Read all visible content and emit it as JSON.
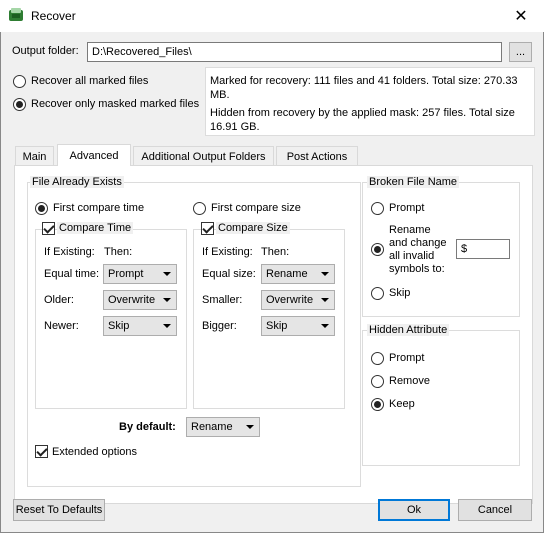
{
  "window": {
    "title": "Recover",
    "close_glyph": "✕"
  },
  "output": {
    "label": "Output folder:",
    "value": "D:\\Recovered_Files\\",
    "browse_label": "..."
  },
  "recover_mode": {
    "all_label": "Recover all marked files",
    "masked_label": "Recover only masked marked files",
    "selected": "masked"
  },
  "info": {
    "marked": "Marked for recovery: 111 files and 41 folders. Total size: 270.33 MB.",
    "hidden": "Hidden from recovery by the applied mask: 257 files. Total size 16.91 GB."
  },
  "tabs": [
    {
      "label": "Main",
      "active": false
    },
    {
      "label": "Advanced",
      "active": true
    },
    {
      "label": "Additional Output Folders",
      "active": false
    },
    {
      "label": "Post Actions",
      "active": false
    }
  ],
  "file_exists": {
    "title": "File Already Exists",
    "first_time_label": "First compare time",
    "first_size_label": "First compare size",
    "first_selected": "time",
    "time": {
      "check_label": "Compare Time",
      "checked": true,
      "if_existing": "If Existing:",
      "then": "Then:",
      "rows": [
        {
          "label": "Equal time:",
          "value": "Prompt"
        },
        {
          "label": "Older:",
          "value": "Overwrite"
        },
        {
          "label": "Newer:",
          "value": "Skip"
        }
      ]
    },
    "size": {
      "check_label": "Compare Size",
      "checked": true,
      "if_existing": "If Existing:",
      "then": "Then:",
      "rows": [
        {
          "label": "Equal size:",
          "value": "Rename"
        },
        {
          "label": "Smaller:",
          "value": "Overwrite"
        },
        {
          "label": "Bigger:",
          "value": "Skip"
        }
      ]
    },
    "default_label": "By default:",
    "default_value": "Rename",
    "extended_label": "Extended options",
    "extended_checked": true
  },
  "broken_name": {
    "title": "Broken File Name",
    "prompt_label": "Prompt",
    "rename_label_1": "Rename",
    "rename_label_2": "and change",
    "rename_label_3": "all invalid",
    "rename_label_4": "symbols to:",
    "rename_value": "$",
    "skip_label": "Skip",
    "selected": "rename"
  },
  "hidden_attr": {
    "title": "Hidden Attribute",
    "prompt_label": "Prompt",
    "remove_label": "Remove",
    "keep_label": "Keep",
    "selected": "keep"
  },
  "footer": {
    "reset_label": "Reset To Defaults",
    "ok_label": "Ok",
    "cancel_label": "Cancel"
  },
  "colors": {
    "accent": "#0078d7",
    "title_icon": "#2e7d32"
  }
}
